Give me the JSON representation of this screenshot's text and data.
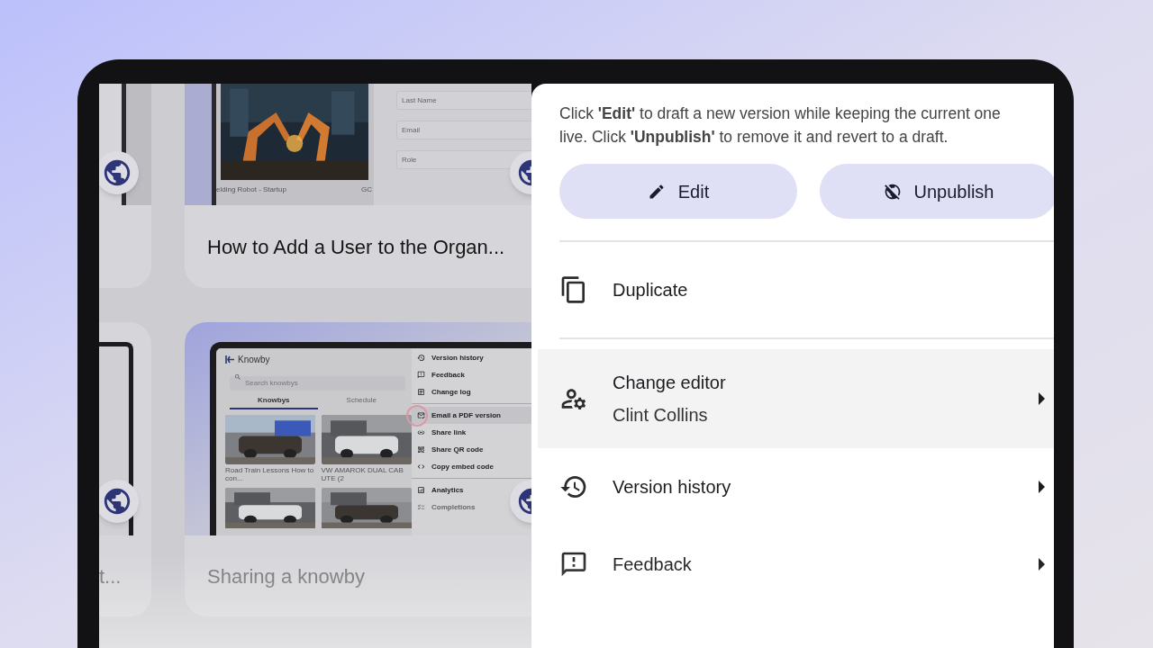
{
  "background_cards": [
    {
      "kind": "form",
      "title": "How to Add a User to the Organ...",
      "photo_caption": "elding Robot - Startup",
      "photo_caption_2": "GC",
      "fields": [
        {
          "placeholder": "Last Name"
        },
        {
          "placeholder": "Email"
        },
        {
          "placeholder": "Role"
        }
      ]
    },
    {
      "kind": "app",
      "title": "Sharing a knowby",
      "app_name": "Knowby",
      "search": {
        "placeholder": "Search knowbys"
      },
      "tabs": [
        {
          "label": "Knowbys",
          "selected": true
        },
        {
          "label": "Schedule",
          "selected": false
        }
      ],
      "items": [
        {
          "title": "Road Train Lessons How to con..."
        },
        {
          "title": "VW AMAROK DUAL CAB UTE (2"
        }
      ],
      "menu": [
        {
          "label": "Version history",
          "highlighted": false,
          "disabled": false,
          "divider_before": false
        },
        {
          "label": "Feedback",
          "highlighted": false,
          "disabled": false,
          "divider_before": false
        },
        {
          "label": "Change log",
          "highlighted": false,
          "disabled": false,
          "divider_before": false
        },
        {
          "label": "Email a PDF version",
          "highlighted": true,
          "disabled": false,
          "divider_before": true
        },
        {
          "label": "Share link",
          "highlighted": false,
          "disabled": false,
          "divider_before": false
        },
        {
          "label": "Share QR code",
          "highlighted": false,
          "disabled": false,
          "divider_before": false
        },
        {
          "label": "Copy embed code",
          "highlighted": false,
          "disabled": false,
          "divider_before": false
        },
        {
          "label": "Analytics",
          "highlighted": false,
          "disabled": false,
          "divider_before": true
        },
        {
          "label": "Completions",
          "highlighted": false,
          "disabled": true,
          "divider_before": false
        }
      ]
    }
  ],
  "side_card": {
    "title": "t..."
  },
  "panel": {
    "description": "Click **'Edit'** to draft a new version while keeping the current one live. Click **'Unpublish'** to remove it and revert to a draft.",
    "buttons": [
      {
        "label": "Edit"
      },
      {
        "label": "Unpublish"
      }
    ],
    "menu": [
      {
        "kind": "action",
        "label": "Duplicate",
        "highlighted": false,
        "divider_after": true
      },
      {
        "kind": "submenu",
        "label": "Change editor",
        "sublabel": "Clint Collins",
        "highlighted": true,
        "divider_after": false
      },
      {
        "kind": "submenu",
        "label": "Version history",
        "highlighted": false,
        "divider_after": false
      },
      {
        "kind": "submenu",
        "label": "Feedback",
        "highlighted": false,
        "divider_after": false
      }
    ]
  }
}
